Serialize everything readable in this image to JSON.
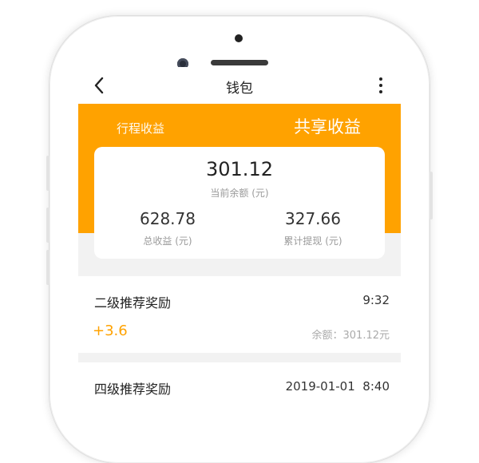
{
  "nav": {
    "title": "钱包",
    "back_icon": "back-chevron-icon",
    "more_icon": "more-vertical-icon"
  },
  "tabs": {
    "trip": "行程收益",
    "share": "共享收益"
  },
  "summary": {
    "balance": "301.12",
    "balance_label": "当前余额 (元)",
    "total_income": "628.78",
    "total_income_label": "总收益 (元)",
    "withdrawn": "327.66",
    "withdrawn_label": "累计提现 (元)"
  },
  "records": [
    {
      "title": "二级推荐奖励",
      "time": "9:32",
      "amount": "+3.6",
      "balance": "余额：301.12元"
    },
    {
      "title": "四级推荐奖励",
      "time": "2019-01-01  8:40"
    }
  ],
  "colors": {
    "accent": "#ffa200",
    "background": "#f2f2f2"
  }
}
